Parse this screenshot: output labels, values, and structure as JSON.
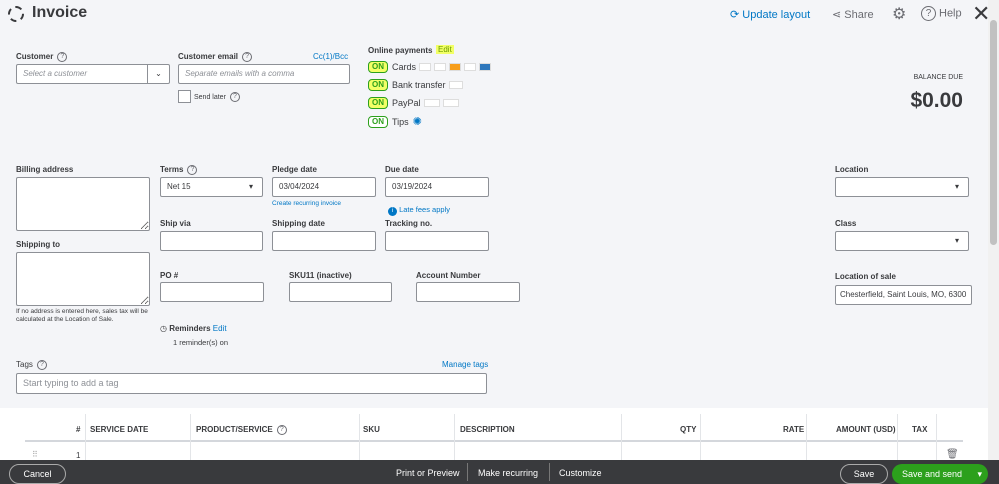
{
  "header": {
    "title": "Invoice",
    "update_layout": "Update layout",
    "share": "Share",
    "help": "Help"
  },
  "customer": {
    "label": "Customer",
    "placeholder": "Select a customer"
  },
  "email": {
    "label": "Customer email",
    "cc": "Cc(1)/Bcc",
    "placeholder": "Separate emails with a comma",
    "send_later": "Send later"
  },
  "online_payments": {
    "label": "Online payments",
    "edit": "Edit",
    "items": [
      {
        "state": "ON",
        "label": "Cards"
      },
      {
        "state": "ON",
        "label": "Bank transfer"
      },
      {
        "state": "ON",
        "label": "PayPal"
      },
      {
        "state": "ON",
        "label": "Tips"
      }
    ]
  },
  "balance": {
    "label": "BALANCE DUE",
    "amount": "$0.00"
  },
  "billing": {
    "label": "Billing address",
    "shipping_label": "Shipping to",
    "note": "If no address is entered here, sales tax will be calculated at the Location of Sale."
  },
  "terms": {
    "label": "Terms",
    "value": "Net 15"
  },
  "pledge_date": {
    "label": "Pledge date",
    "value": "03/04/2024",
    "recurring": "Create recurring invoice"
  },
  "due_date": {
    "label": "Due date",
    "value": "03/19/2024",
    "late_fees": "Late fees apply"
  },
  "ship_via": {
    "label": "Ship via"
  },
  "shipping_date": {
    "label": "Shipping date"
  },
  "tracking": {
    "label": "Tracking no."
  },
  "po": {
    "label": "PO #"
  },
  "sku11": {
    "label": "SKU11 (inactive)"
  },
  "account_number": {
    "label": "Account Number"
  },
  "reminders": {
    "label": "Reminders",
    "edit": "Edit",
    "count": "1 reminder(s) on"
  },
  "location": {
    "label": "Location"
  },
  "class": {
    "label": "Class"
  },
  "location_of_sale": {
    "label": "Location of sale",
    "value": "Chesterfield, Saint Louis, MO, 6300"
  },
  "tags": {
    "label": "Tags",
    "manage": "Manage tags",
    "placeholder": "Start typing to add a tag"
  },
  "table": {
    "headers": [
      "#",
      "SERVICE DATE",
      "PRODUCT/SERVICE",
      "SKU",
      "DESCRIPTION",
      "QTY",
      "RATE",
      "AMOUNT (USD)",
      "TAX"
    ],
    "row_number": "1"
  },
  "footer": {
    "cancel": "Cancel",
    "print": "Print or Preview",
    "recurring": "Make recurring",
    "customize": "Customize",
    "save": "Save",
    "save_send": "Save and send"
  }
}
